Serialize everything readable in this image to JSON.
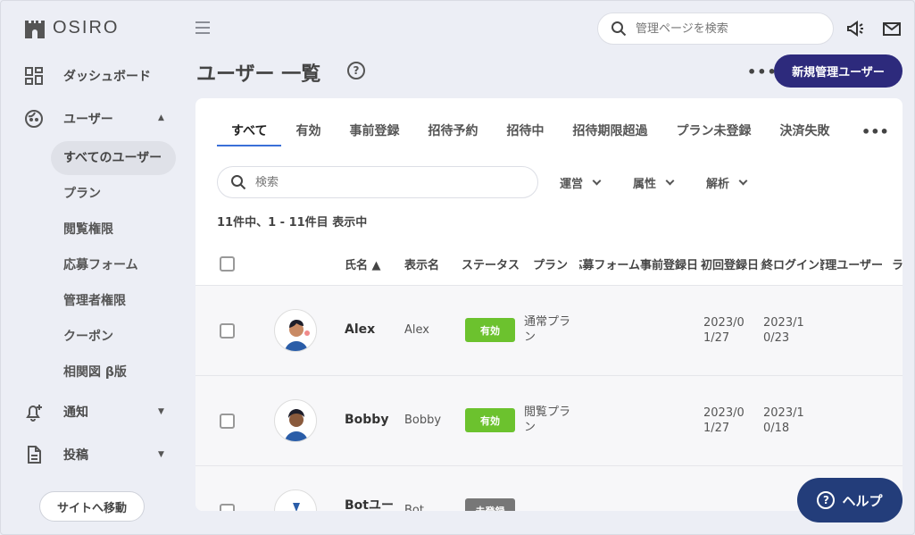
{
  "brand": {
    "name": "OSIRO"
  },
  "sidebar": {
    "items": [
      {
        "label": "ダッシュボード",
        "icon": "dashboard-icon"
      },
      {
        "label": "ユーザー",
        "icon": "user-face-icon"
      },
      {
        "label": "通知",
        "icon": "bell-plus-icon"
      },
      {
        "label": "投稿",
        "icon": "document-icon"
      }
    ],
    "user_sub": [
      "すべてのユーザー",
      "プラン",
      "閲覧権限",
      "応募フォーム",
      "管理者権限",
      "クーポン",
      "相関図 β版"
    ],
    "site_button": "サイトへ移動"
  },
  "header": {
    "search_placeholder": "管理ページを検索",
    "title": "ユーザー 一覧",
    "help_mark": "?",
    "more": "•••",
    "new_admin_button": "新規管理ユーザー"
  },
  "tabs": [
    "すべて",
    "有効",
    "事前登録",
    "招待予約",
    "招待中",
    "招待期限超過",
    "プラン未登録",
    "決済失敗"
  ],
  "tabs_more": "•••",
  "filters": {
    "search_placeholder": "検索",
    "items": [
      "運営",
      "属性",
      "解析"
    ]
  },
  "count_text": "11件中、1 - 11件目 表示中",
  "table": {
    "headers": [
      "氏名 ▲",
      "表示名",
      "ステータス",
      "プラン",
      "応募フォーム",
      "事前登録日",
      "初回登録日",
      "最終ログイン",
      "管理ユーザー",
      "ラ"
    ],
    "rows": [
      {
        "name": "Alex",
        "display": "Alex",
        "status": "有効",
        "plan": "通常プラン",
        "first_reg": "2023/01/27",
        "last_login": "2023/10/23"
      },
      {
        "name": "Bobby",
        "display": "Bobby",
        "status": "有効",
        "plan": "閲覧プラン",
        "first_reg": "2023/01/27",
        "last_login": "2023/10/18"
      },
      {
        "name": "Botユー",
        "display": "Bot",
        "status": "未登録"
      }
    ]
  },
  "help_button": {
    "mark": "?",
    "label": "ヘルプ"
  },
  "colors": {
    "primary": "#2d2a7c",
    "active_badge": "#6cc22e",
    "inactive_badge": "#777777",
    "help": "#233d7a"
  }
}
